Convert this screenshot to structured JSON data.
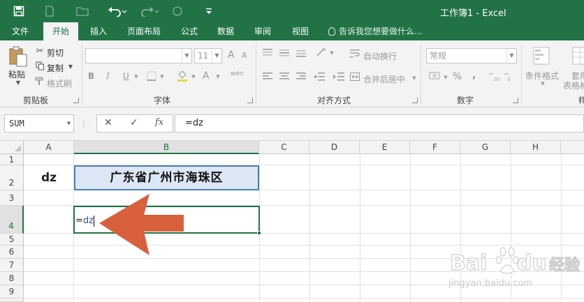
{
  "app": {
    "title": "工作簿1 - Excel",
    "accent": "#217346"
  },
  "quick_access": {
    "icons": [
      "save-icon",
      "new-file-icon",
      "open-folder-icon",
      "undo-icon",
      "redo-icon",
      "touch-mode-icon",
      "customize-qat-icon"
    ]
  },
  "tabs": [
    {
      "label": "文件"
    },
    {
      "label": "开始",
      "active": true
    },
    {
      "label": "插入"
    },
    {
      "label": "页面布局"
    },
    {
      "label": "公式"
    },
    {
      "label": "数据"
    },
    {
      "label": "审阅"
    },
    {
      "label": "视图"
    }
  ],
  "tell_me": "告诉我您想要做什么...",
  "ribbon": {
    "clipboard": {
      "paste": "粘贴",
      "cut": "剪切",
      "copy": "复制",
      "format_painter": "格式刷",
      "group": "剪贴板"
    },
    "font": {
      "name_value": "",
      "size_value": "11",
      "bold": "B",
      "italic": "I",
      "underline": "U",
      "font_color": "A",
      "phonetic": "wén",
      "grow": "A",
      "shrink": "A",
      "group": "字体"
    },
    "alignment": {
      "wrap": "自动换行",
      "merge": "合并后居中",
      "group": "对齐方式"
    },
    "number": {
      "format_value": "常规",
      "percent": "%",
      "comma": ",",
      "group": "数字"
    },
    "styles": {
      "conditional": "条件格式",
      "table_format_1": "套用",
      "table_format_2": "表格格",
      "group_partial": "样"
    }
  },
  "formula_bar": {
    "name_box": "SUM",
    "cancel": "✕",
    "enter": "✓",
    "fx": "fx",
    "formula": "=dz"
  },
  "grid": {
    "columns": [
      "A",
      "B",
      "C",
      "D",
      "E",
      "F",
      "G",
      "H"
    ],
    "rows": [
      "1",
      "2",
      "3",
      "4",
      "5",
      "6",
      "7",
      "8",
      "9"
    ],
    "selected_column": "B",
    "selected_row": "4",
    "cells": {
      "A2": "dz",
      "B2": "广东省广州市海珠区",
      "B4_prefix": "=",
      "B4_ref": "dz"
    }
  },
  "annotation": {
    "arrow_color": "#d9603d"
  },
  "watermark": {
    "brand": "Bai du 经验",
    "url": "jingyan.baidu.com"
  }
}
